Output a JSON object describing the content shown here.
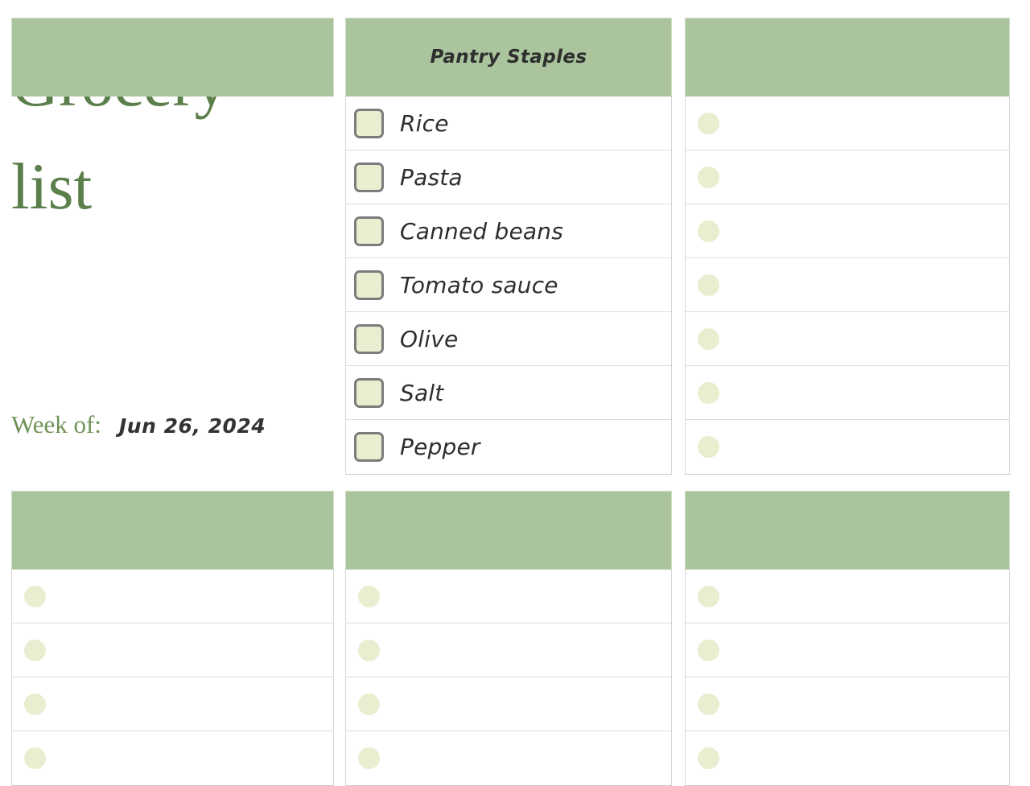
{
  "title": "Grocery\nlist",
  "week": {
    "label": "Week of:",
    "value": "Jun 26, 2024"
  },
  "colors": {
    "title_green": "#5b7f4a",
    "header_green": "#aac49d",
    "marker_green": "#e8eecf",
    "item_text": "#2e2e2e",
    "row_divider": "#dcdcdc"
  },
  "categories": [
    {
      "id": "top-left-empty",
      "title": "",
      "marker": "none",
      "position": "top-left",
      "items": []
    },
    {
      "id": "pantry-staples",
      "title": "Pantry Staples",
      "marker": "checkbox",
      "position": "top-middle",
      "items": [
        {
          "label": "Rice",
          "checked": false
        },
        {
          "label": "Pasta",
          "checked": false
        },
        {
          "label": "Canned beans",
          "checked": false
        },
        {
          "label": "Tomato sauce",
          "checked": false
        },
        {
          "label": "Olive",
          "checked": false
        },
        {
          "label": "Salt",
          "checked": false
        },
        {
          "label": "Pepper",
          "checked": false
        }
      ]
    },
    {
      "id": "top-right",
      "title": "",
      "marker": "dot",
      "position": "top-right",
      "items": [
        {
          "label": ""
        },
        {
          "label": ""
        },
        {
          "label": ""
        },
        {
          "label": ""
        },
        {
          "label": ""
        },
        {
          "label": ""
        },
        {
          "label": ""
        }
      ]
    },
    {
      "id": "bottom-left",
      "title": "",
      "marker": "dot",
      "position": "bottom-left",
      "items": [
        {
          "label": ""
        },
        {
          "label": ""
        },
        {
          "label": ""
        },
        {
          "label": ""
        }
      ]
    },
    {
      "id": "bottom-middle",
      "title": "",
      "marker": "dot",
      "position": "bottom-middle",
      "items": [
        {
          "label": ""
        },
        {
          "label": ""
        },
        {
          "label": ""
        },
        {
          "label": ""
        }
      ]
    },
    {
      "id": "bottom-right",
      "title": "",
      "marker": "dot",
      "position": "bottom-right",
      "items": [
        {
          "label": ""
        },
        {
          "label": ""
        },
        {
          "label": ""
        },
        {
          "label": ""
        }
      ]
    }
  ]
}
